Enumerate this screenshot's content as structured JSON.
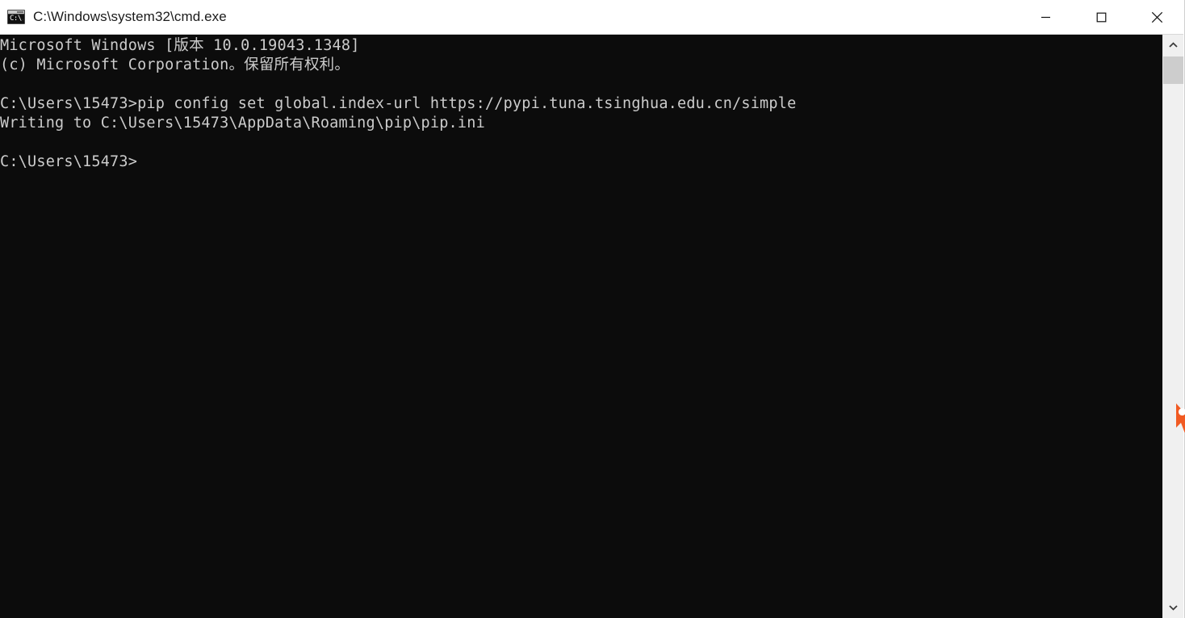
{
  "window": {
    "title": "C:\\Windows\\system32\\cmd.exe",
    "icon": "cmd-icon",
    "icon_glyph": "C:\\.",
    "background_color": "#0c0c0c",
    "text_color": "#cccccc",
    "titlebar_color": "#ffffff"
  },
  "caption_buttons": [
    {
      "name": "minimize-button",
      "label": "Minimize",
      "glyph": "—"
    },
    {
      "name": "maximize-button",
      "label": "Maximize",
      "glyph": "□"
    },
    {
      "name": "close-button",
      "label": "Close",
      "glyph": "✕"
    }
  ],
  "console": {
    "lines": [
      "Microsoft Windows [版本 10.0.19043.1348]",
      "(c) Microsoft Corporation。保留所有权利。",
      "",
      "C:\\Users\\15473>pip config set global.index-url https://pypi.tuna.tsinghua.edu.cn/simple",
      "Writing to C:\\Users\\15473\\AppData\\Roaming\\pip\\pip.ini",
      "",
      "C:\\Users\\15473>"
    ],
    "prompt": "C:\\Users\\15473>",
    "last_command": "pip config set global.index-url https://pypi.tuna.tsinghua.edu.cn/simple",
    "command_output": "Writing to C:\\Users\\15473\\AppData\\Roaming\\pip\\pip.ini",
    "os_banner": "Microsoft Windows [版本 10.0.19043.1348]",
    "copyright": "(c) Microsoft Corporation。保留所有权利。"
  },
  "scrollbar": {
    "up_arrow": "scroll-up-arrow",
    "down_arrow": "scroll-down-arrow",
    "thumb": "scroll-thumb",
    "track_color": "#f0f0f0",
    "thumb_color": "#cdcdcd"
  },
  "cursor": {
    "name": "mouse-pointer",
    "color": "#f15a22"
  }
}
